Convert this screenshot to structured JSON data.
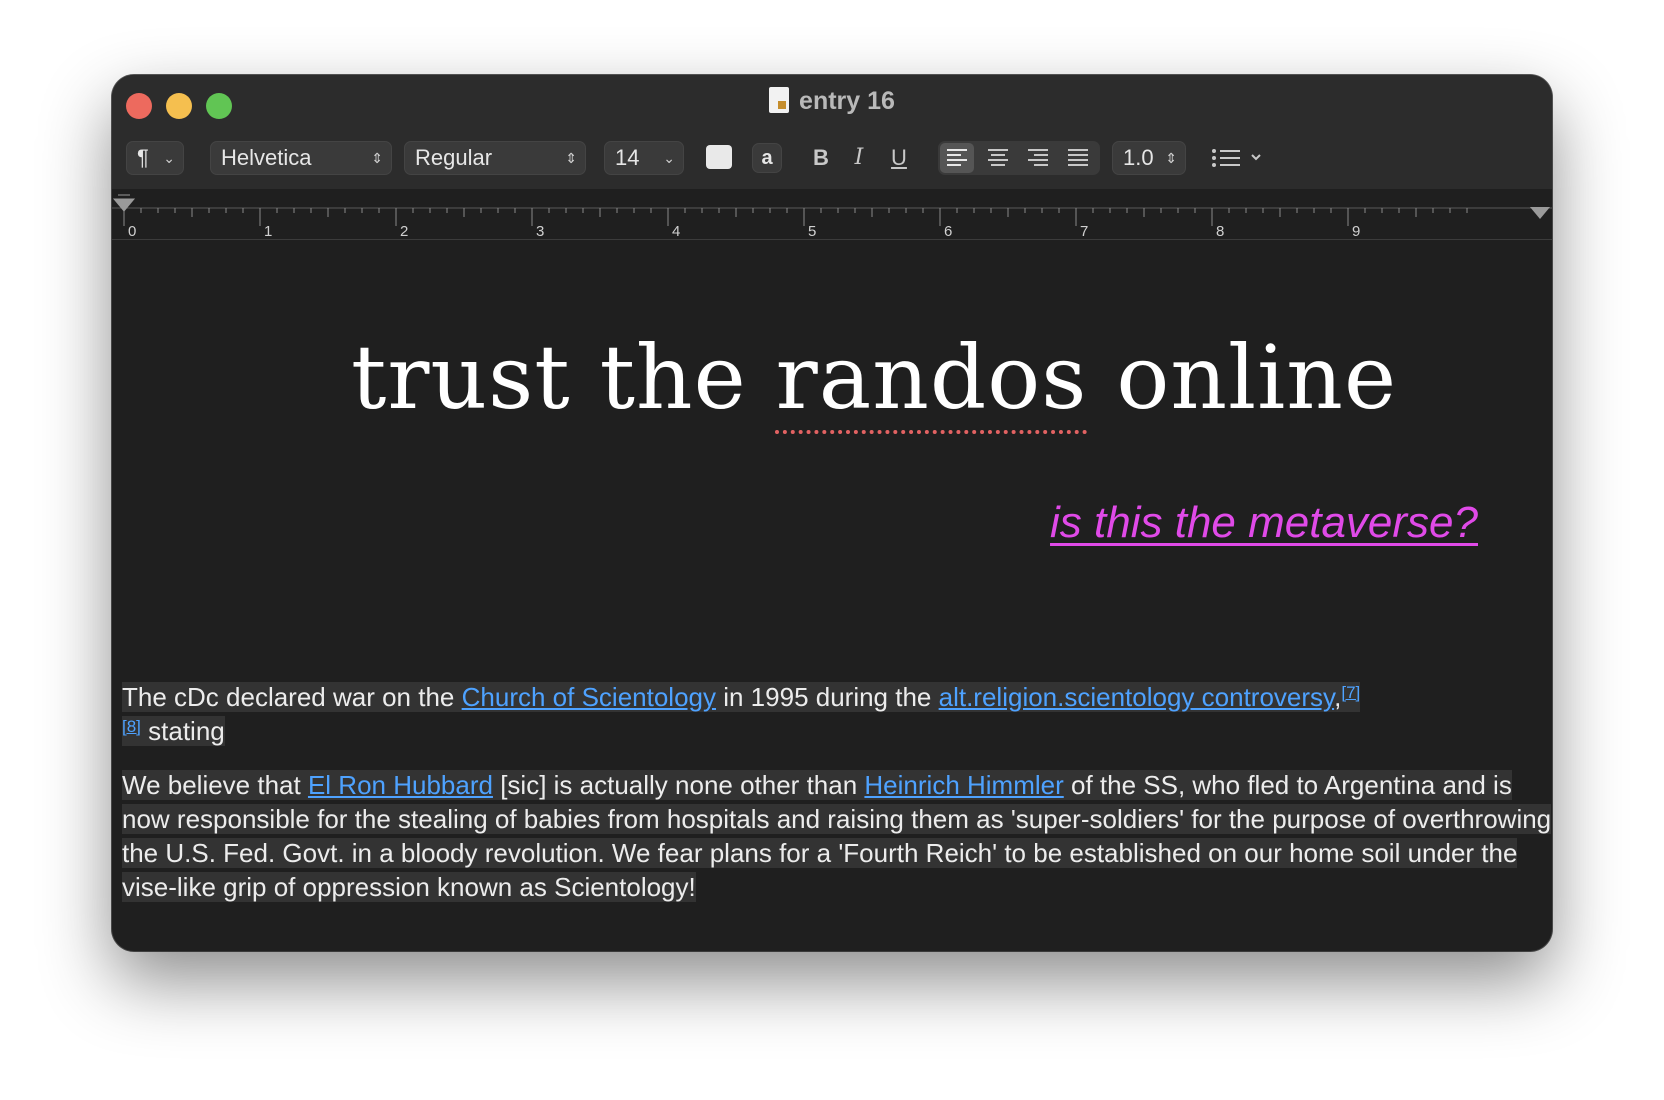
{
  "window": {
    "title": "entry 16"
  },
  "toolbar": {
    "paragraph_style": "¶",
    "font_family": "Helvetica",
    "font_style": "Regular",
    "font_size": "14",
    "bg_color_label": "a",
    "bold": "B",
    "italic": "I",
    "underline": "U",
    "line_spacing": "1.0"
  },
  "ruler": {
    "ticks": [
      "0",
      "1",
      "2",
      "3",
      "4",
      "5",
      "6",
      "7",
      "8",
      "9"
    ]
  },
  "document": {
    "heading_pre": "trust the ",
    "heading_misspelled": "randos",
    "heading_post": " online",
    "subheading": "is this the metaverse?",
    "p1_a": "The cDc declared war on the ",
    "p1_link1": "Church of Scientology",
    "p1_b": " in 1995 during the ",
    "p1_link2": "alt.religion.scientology controversy",
    "p1_c": ",",
    "p1_ref1": "[7]",
    "p1_ref2": "[8]",
    "p1_d": " stating",
    "p2_a": "We believe that ",
    "p2_link1": "El Ron Hubbard",
    "p2_b": " [sic] is actually none other than ",
    "p2_link2": "Heinrich Himmler",
    "p2_c": " of the SS, who fled to Argentina and is now responsible for the stealing of babies from hospitals and raising them as 'super-soldiers' for the purpose of overthrowing the U.S. Fed. Govt. in a bloody revolution. We fear plans for a 'Fourth Reich' to be established on our home soil under the vise-like grip of oppression known as Scientology!"
  },
  "colors": {
    "link": "#4ea2ff",
    "subheading": "#e04ae8",
    "spellcheck": "#e26262",
    "window_bg": "#1f1f1f"
  }
}
